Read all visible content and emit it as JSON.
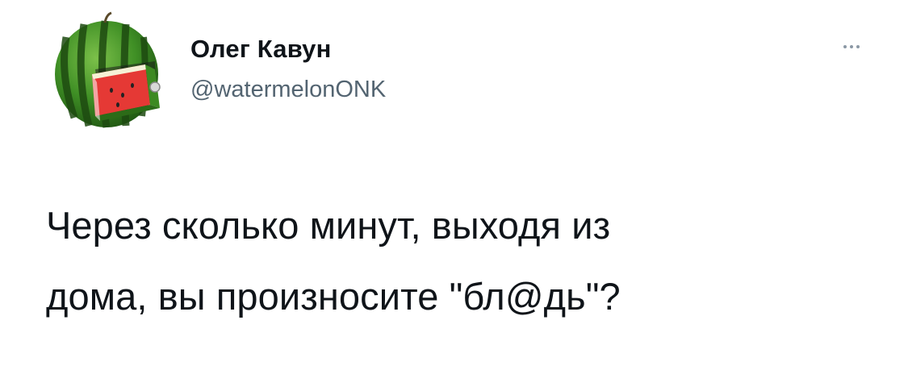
{
  "author": {
    "display_name": "Олег Кавун",
    "handle": "@watermelonONK",
    "avatar_icon": "watermelon-avatar-icon"
  },
  "menu": {
    "icon": "more-horizontal-icon"
  },
  "tweet": {
    "lines": [
      "Через сколько минут, выходя из",
      "дома, вы произносите \"бл@дь\"?"
    ]
  },
  "colors": {
    "text_primary": "#0f1419",
    "text_secondary": "#536471",
    "background": "#ffffff",
    "watermelon_green": "#2f7a1f",
    "watermelon_red": "#d62a2a"
  }
}
